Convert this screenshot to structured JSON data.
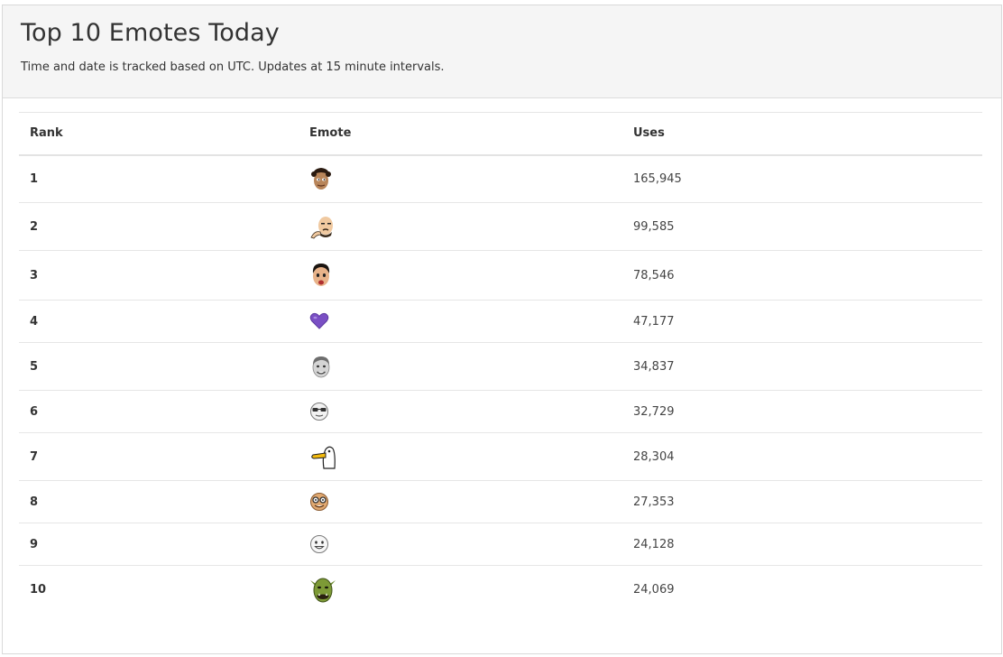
{
  "header": {
    "title": "Top 10 Emotes Today",
    "subtitle": "Time and date is tracked based on UTC. Updates at 15 minute intervals."
  },
  "table": {
    "columns": [
      "Rank",
      "Emote",
      "Uses"
    ],
    "rows": [
      {
        "rank": "1",
        "emote_icon": "curly-hair-face-emote-icon",
        "uses": "165,945"
      },
      {
        "rank": "2",
        "emote_icon": "bald-thinking-face-emote-icon",
        "uses": "99,585"
      },
      {
        "rank": "3",
        "emote_icon": "surprised-face-emote-icon",
        "uses": "78,546"
      },
      {
        "rank": "4",
        "emote_icon": "purple-heart-emote-icon",
        "uses": "47,177"
      },
      {
        "rank": "5",
        "emote_icon": "grayscale-smile-face-emote-icon",
        "uses": "34,837"
      },
      {
        "rank": "6",
        "emote_icon": "glasses-face-emote-icon",
        "uses": "32,729"
      },
      {
        "rank": "7",
        "emote_icon": "goose-emote-icon",
        "uses": "28,304"
      },
      {
        "rank": "8",
        "emote_icon": "nerd-glasses-face-emote-icon",
        "uses": "27,353"
      },
      {
        "rank": "9",
        "emote_icon": "white-smile-face-emote-icon",
        "uses": "24,128"
      },
      {
        "rank": "10",
        "emote_icon": "green-orc-emote-icon",
        "uses": "24,069"
      }
    ]
  }
}
